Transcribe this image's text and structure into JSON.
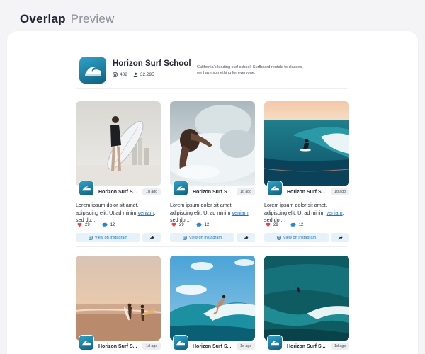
{
  "page": {
    "title_word1": "Overlap",
    "title_word2": "Preview"
  },
  "profile": {
    "name": "Horizon Surf School",
    "posts_count": "402",
    "followers_count": "32,295",
    "bio": "California's leading surf school. Surfboard rentals to classes, we have something for everyone."
  },
  "posts": [
    {
      "author": "Horizon Surf S...",
      "time": "1d ago",
      "caption_start": "Lorem ipsum dolor sit amet, adipiscing elit. Ut ad minim ",
      "caption_link": "veniam",
      "caption_end": ", sed do...",
      "likes": "29",
      "comments": "12",
      "button_label": "View on Instagram"
    },
    {
      "author": "Horizon Surf S...",
      "time": "1d ago",
      "caption_start": "Lorem ipsum dolor sit amet, adipiscing elit. Ut ad minim ",
      "caption_link": "veniam",
      "caption_end": ", sed do...",
      "likes": "29",
      "comments": "12",
      "button_label": "View on Instagram"
    },
    {
      "author": "Horizon Surf S...",
      "time": "1d ago",
      "caption_start": "Lorem ipsum dolor sit amet, adipiscing elit. Ut ad minim ",
      "caption_link": "veniam",
      "caption_end": ", sed do...",
      "likes": "29",
      "comments": "12",
      "button_label": "View on Instagram"
    },
    {
      "author": "Horizon Surf S...",
      "time": "1d ago"
    },
    {
      "author": "Horizon Surf S...",
      "time": "1d ago"
    },
    {
      "author": "Horizon Surf S...",
      "time": "1d ago"
    }
  ],
  "colors": {
    "accent": "#2472b8",
    "brand": "#1a7fa6",
    "heart": "#e0464b"
  },
  "icons": {
    "posts": "instagram-icon",
    "followers": "person-icon",
    "likes": "heart-icon",
    "comments": "comment-icon",
    "share": "share-icon",
    "brand": "wave-logo-icon"
  }
}
